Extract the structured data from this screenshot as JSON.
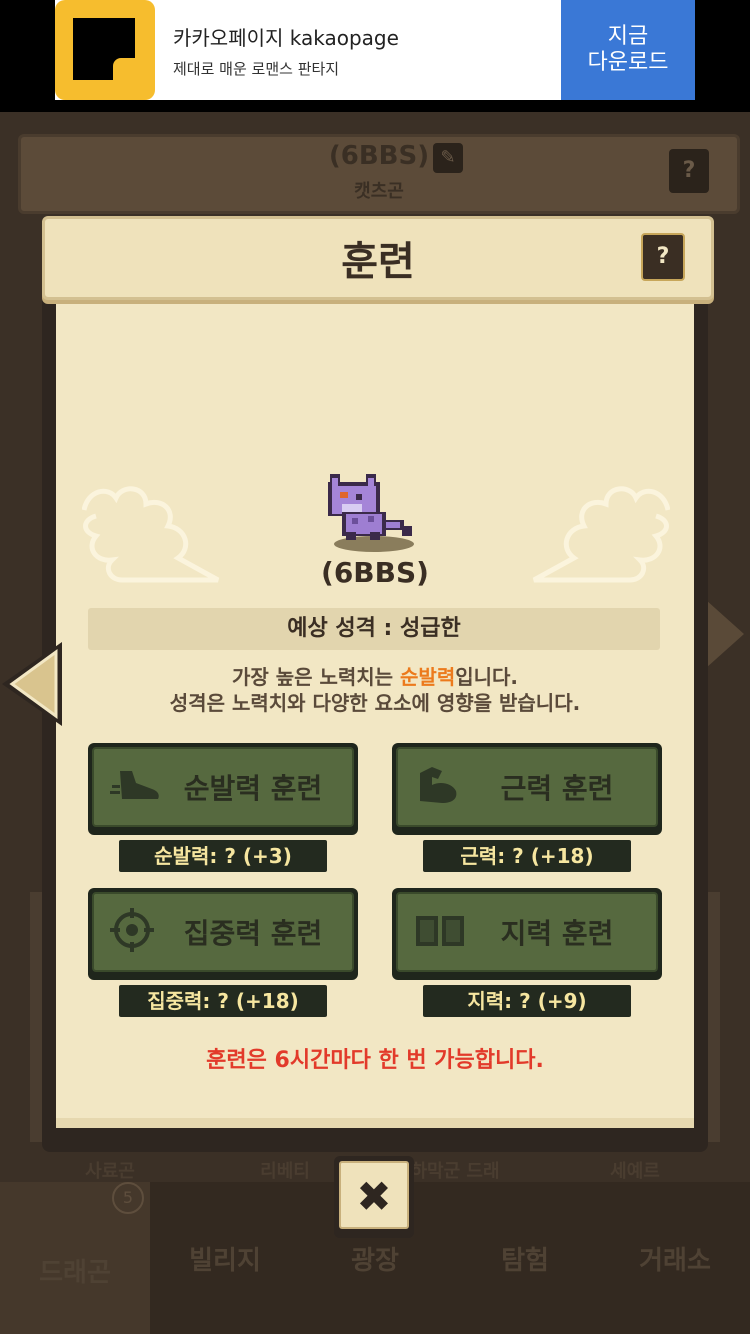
{
  "ad": {
    "title": "카카오페이지 kakaopage",
    "subtitle": "제대로 매운 로맨스 판타지",
    "cta": "지금\n다운로드"
  },
  "background": {
    "dragon_name": "(6BBS)",
    "dragon_species": "캣츠곤",
    "help": "?",
    "side_labels": [
      "사료곤",
      "리베티",
      "하막군 드래",
      "세예르"
    ],
    "tabs": [
      {
        "label": "드래곤",
        "badge": "5",
        "active": true
      },
      {
        "label": "빌리지"
      },
      {
        "label": "광장"
      },
      {
        "label": "탐험"
      },
      {
        "label": "거래소"
      }
    ]
  },
  "modal": {
    "title": "훈련",
    "help": "?",
    "cat_name": "(6BBS)",
    "personality": "예상 성격 : 성급한",
    "desc_line1_pre": "가장 높은 노력치는 ",
    "desc_line1_hl": "순발력",
    "desc_line1_post": "입니다.",
    "desc_line2": "성격은 노력치와 다양한 요소에 영향을 받습니다.",
    "buttons": [
      {
        "label": "순발력 훈련",
        "icon": "shoe-icon",
        "stat": "순발력: ? (+3)"
      },
      {
        "label": "근력 훈련",
        "icon": "muscle-icon",
        "stat": "근력: ? (+18)"
      },
      {
        "label": "집중력 훈련",
        "icon": "crosshair-icon",
        "stat": "집중력: ? (+18)"
      },
      {
        "label": "지력 훈련",
        "icon": "book-icon",
        "stat": "지력: ? (+9)"
      }
    ],
    "notice": "훈련은 6시간마다 한 번 가능합니다.",
    "close": "✖"
  },
  "colors": {
    "accent": "#ec7a1c",
    "notice": "#e23a2a",
    "button_green": "#56693f",
    "parchment": "#f2e7c4"
  }
}
